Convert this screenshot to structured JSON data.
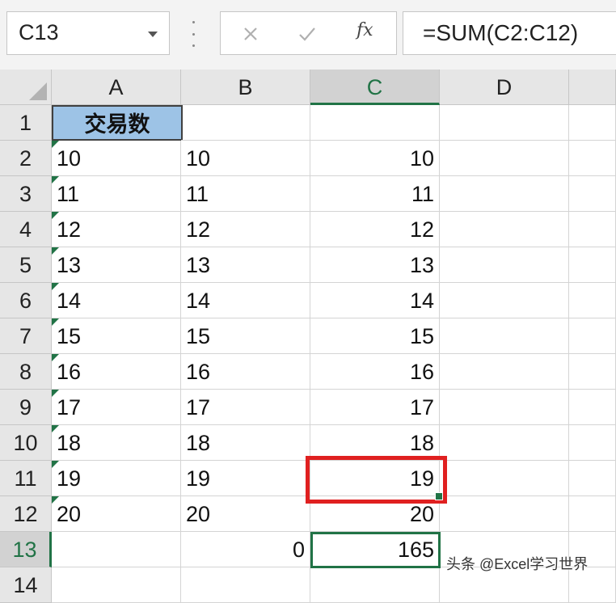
{
  "name_box": {
    "value": "C13"
  },
  "formula_bar": {
    "formula": "=SUM(C2:C12)",
    "fx_label": "fx"
  },
  "columns": [
    "A",
    "B",
    "C",
    "D"
  ],
  "rows": [
    "1",
    "2",
    "3",
    "4",
    "5",
    "6",
    "7",
    "8",
    "9",
    "10",
    "11",
    "12",
    "13",
    "14"
  ],
  "cells": {
    "A1": "交易数",
    "A": [
      "10",
      "11",
      "12",
      "13",
      "14",
      "15",
      "16",
      "17",
      "18",
      "19",
      "20"
    ],
    "B": [
      "10",
      "11",
      "12",
      "13",
      "14",
      "15",
      "16",
      "17",
      "18",
      "19",
      "20"
    ],
    "C": [
      "10",
      "11",
      "12",
      "13",
      "14",
      "15",
      "16",
      "17",
      "18",
      "19",
      "20"
    ],
    "B13": "0",
    "C13": "165"
  },
  "selection": {
    "cell": "C13",
    "column": "C",
    "row": "13"
  },
  "colors": {
    "accent": "#217346",
    "header_fill": "#9dc3e6",
    "highlight": "#e02020"
  },
  "watermark": "头条 @Excel学习世界"
}
